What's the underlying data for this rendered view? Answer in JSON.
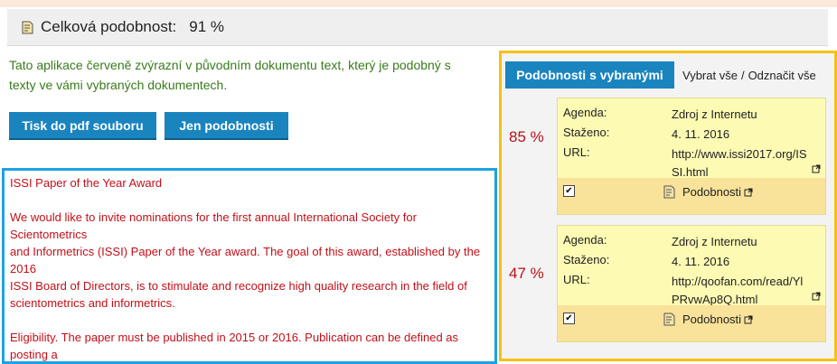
{
  "summary": {
    "label": "Celková podobnost:",
    "value": "91 %"
  },
  "info_text": "Tato aplikace červeně zvýrazní v původním dokumentu text, který je podobný s texty ve vámi vybraných dokumentech.",
  "buttons": {
    "pdf": "Tisk do pdf souboru",
    "similarities": "Jen podobnosti"
  },
  "document": {
    "lines": [
      "ISSI Paper of the Year Award",
      "",
      "We would like to invite nominations for the first annual International Society for Scientometrics",
      "and Informetrics (ISSI) Paper of the Year award. The goal of this award, established by the 2016",
      "ISSI Board of Directors, is to stimulate and recognize high quality research in the field of scientometrics and informetrics.",
      "",
      "Eligibility. The paper must be published in 2015 or 2016. Publication can be defined as posting a"
    ]
  },
  "panel": {
    "tab_active": "Podobnosti s vybranými",
    "select_all": "Vybrat vše",
    "separator": "/",
    "deselect_all": "Odznačit vše",
    "results": [
      {
        "percent": "85 %",
        "agenda_label": "Agenda:",
        "agenda": "Zdroj z Internetu",
        "downloaded_label": "Staženo:",
        "downloaded": "4. 11. 2016",
        "url_label": "URL:",
        "url": "http://www.issi2017.org/ISSI.html",
        "checked": "✔",
        "similar_label": "Podobnosti"
      },
      {
        "percent": "47 %",
        "agenda_label": "Agenda:",
        "agenda": "Zdroj z Internetu",
        "downloaded_label": "Staženo:",
        "downloaded": "4. 11. 2016",
        "url_label": "URL:",
        "url": "http://qoofan.com/read/YlPRvwAp8Q.html",
        "checked": "✔",
        "similar_label": "Podobnosti"
      }
    ]
  },
  "colors": {
    "accent_blue": "#1a84bf",
    "highlight_red": "#c0101a",
    "panel_border": "#f6c012",
    "doc_border": "#1ba3e4"
  }
}
